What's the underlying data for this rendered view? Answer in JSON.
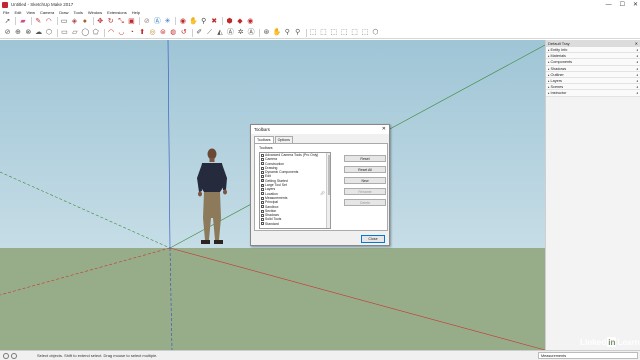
{
  "window": {
    "title": "Untitled - SketchUp Make 2017",
    "controls": [
      "—",
      "☐",
      "✕"
    ]
  },
  "menu": [
    "File",
    "Edit",
    "View",
    "Camera",
    "Draw",
    "Tools",
    "Window",
    "Extensions",
    "Help"
  ],
  "toolbar1": [
    "select-icon",
    "eraser-icon",
    "pencil-icon",
    "arc-icon",
    "rectangle-icon",
    "pushpull-icon",
    "paint-bucket-icon",
    "move-icon",
    "rotate-icon",
    "scale-icon",
    "offset-icon",
    "tape-icon",
    "text-icon",
    "axes-icon",
    "orbit-icon",
    "pan-icon",
    "zoom-icon",
    "zoom-extents-icon",
    "warehouse-icon",
    "extension-icon",
    "share-icon"
  ],
  "toolbar2": [
    "select-icon",
    "line-icon",
    "freehand-icon",
    "shape-icon",
    "polygon-icon",
    "circle-icon",
    "arc2-icon",
    "rect-icon",
    "rotated-rect-icon",
    "push-icon",
    "follow-icon",
    "move2-icon",
    "rotate2-icon",
    "scale2-icon",
    "offset2-icon",
    "tape2-icon",
    "dimension-icon",
    "protractor-icon",
    "text2-icon",
    "axes2-icon",
    "3dtext-icon",
    "orbit2-icon",
    "pan2-icon",
    "zoom2-icon",
    "zoomwin-icon",
    "zoomext-icon",
    "iso-icon",
    "top-icon",
    "front-icon",
    "right-icon",
    "back-icon",
    "left-icon",
    "xray-icon",
    "wireframe-icon",
    "hidden-icon",
    "shaded-icon",
    "textured-icon",
    "mono-icon"
  ],
  "tray": {
    "title": "Default Tray",
    "items": [
      "Entity Info",
      "Materials",
      "Components",
      "Shadows",
      "Outliner",
      "Layers",
      "Scenes",
      "Instructor"
    ]
  },
  "dialog": {
    "title": "Toolbars",
    "close": "✕",
    "tabs": [
      "Toolbars",
      "Options"
    ],
    "group_label": "Toolbars",
    "items": [
      {
        "label": "Advanced Camera Tools (Pro Only)",
        "checked": false
      },
      {
        "label": "Camera",
        "checked": false
      },
      {
        "label": "Construction",
        "checked": false
      },
      {
        "label": "Drawing",
        "checked": false
      },
      {
        "label": "Dynamic Components",
        "checked": false
      },
      {
        "label": "Edit",
        "checked": false
      },
      {
        "label": "Getting Started",
        "checked": true
      },
      {
        "label": "Large Tool Set",
        "checked": true
      },
      {
        "label": "Layers",
        "checked": false
      },
      {
        "label": "Location",
        "checked": false
      },
      {
        "label": "Measurements",
        "checked": false
      },
      {
        "label": "Principal",
        "checked": false
      },
      {
        "label": "Sandbox",
        "checked": false
      },
      {
        "label": "Section",
        "checked": false
      },
      {
        "label": "Shadows",
        "checked": false
      },
      {
        "label": "Solid Tools",
        "checked": false
      },
      {
        "label": "Standard",
        "checked": false
      }
    ],
    "buttons": [
      "Reset",
      "Reset All",
      "New",
      "Rename",
      "Delete"
    ],
    "close_button": "Close"
  },
  "status": {
    "text": "Select objects. Shift to extend select. Drag mouse to select multiple.",
    "measurements_label": "Measurements"
  },
  "watermark": {
    "left": "Linked",
    "box": "in",
    "right": "Learning"
  }
}
